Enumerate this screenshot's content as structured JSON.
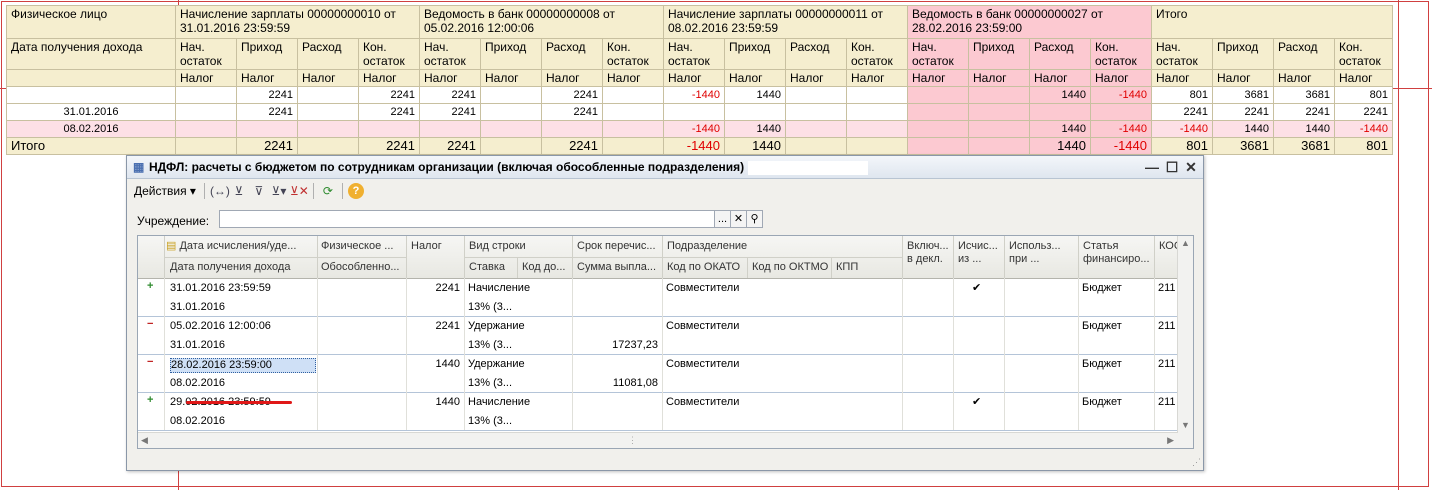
{
  "report": {
    "col_person": "Физическое лицо",
    "col_income_date": "Дата получения дохода",
    "groups": [
      {
        "title": "Начисление зарплаты 00000000010 от 31.01.2016 23:59:59"
      },
      {
        "title": "Ведомость в банк 00000000008 от 05.02.2016 12:00:06"
      },
      {
        "title": "Начисление зарплаты 00000000011 от 08.02.2016 23:59:59"
      },
      {
        "title": "Ведомость в банк 00000000027 от 28.02.2016 23:59:00"
      },
      {
        "title": "Итого"
      }
    ],
    "sub_cols": [
      "Нач. остаток",
      "Приход",
      "Расход",
      "Кон. остаток"
    ],
    "tax_label": "Налог",
    "rows": [
      {
        "label": "",
        "values": [
          "",
          "2241",
          "",
          "2241",
          "2241",
          "",
          "2241",
          "",
          "-1440",
          "1440",
          "",
          "",
          "",
          "",
          "1440",
          "-1440",
          "801",
          "3681",
          "3681",
          "801"
        ]
      },
      {
        "label": "31.01.2016",
        "values": [
          "",
          "2241",
          "",
          "2241",
          "2241",
          "",
          "2241",
          "",
          "",
          "",
          "",
          "",
          "",
          "",
          "",
          "",
          "2241",
          "2241",
          "2241",
          "2241"
        ]
      },
      {
        "label": "08.02.2016",
        "values": [
          "",
          "",
          "",
          "",
          "",
          "",
          "",
          "",
          "-1440",
          "1440",
          "",
          "",
          "",
          "",
          "1440",
          "-1440",
          "-1440",
          "1440",
          "1440",
          "-1440"
        ]
      }
    ],
    "total": {
      "label": "Итого",
      "values": [
        "",
        "2241",
        "",
        "2241",
        "2241",
        "",
        "2241",
        "",
        "-1440",
        "1440",
        "",
        "",
        "",
        "",
        "1440",
        "-1440",
        "801",
        "3681",
        "3681",
        "801"
      ]
    }
  },
  "dialog": {
    "title": "НДФЛ: расчеты с бюджетом по сотрудникам организации (включая обособленные подразделения)",
    "actions_label": "Действия",
    "institution_label": "Учреждение:",
    "institution_value": "",
    "columns": {
      "calc_date": "Дата исчисления/уде...",
      "income_date": "Дата получения дохода",
      "person": "Физическое ...",
      "separate": "Обособленно...",
      "tax": "Налог",
      "row_type": "Вид строки",
      "rate": "Ставка",
      "income_code": "Код до...",
      "transfer_term": "Срок перечис...",
      "payout_sum": "Сумма выпла...",
      "department": "Подразделение",
      "okato": "Код по ОКАТО",
      "oktmo": "Код по ОКТМО",
      "kpp": "КПП",
      "included": "Включ... в декл.",
      "excluded": "Исчис... из ...",
      "used": "Использ... при ...",
      "fin_article": "Статья финансиро...",
      "kosgu": "КОС"
    },
    "rows": [
      {
        "sign": "+",
        "calc_date": "31.01.2016 23:59:59",
        "income_date": "31.01.2016",
        "tax": "2241",
        "row_type": "Начисление",
        "rate": "13% (3...",
        "payout_sum": "",
        "department": "Совместители",
        "excluded_check": "✔",
        "fin_article": "Бюджет",
        "kosgu": "211"
      },
      {
        "sign": "−",
        "calc_date": "05.02.2016 12:00:06",
        "income_date": "31.01.2016",
        "tax": "2241",
        "row_type": "Удержание",
        "rate": "13% (3...",
        "payout_sum": "17237,23",
        "department": "Совместители",
        "excluded_check": "",
        "fin_article": "Бюджет",
        "kosgu": "211"
      },
      {
        "sign": "−",
        "calc_date": "28.02.2016 23:59:00",
        "income_date": "08.02.2016",
        "tax": "1440",
        "row_type": "Удержание",
        "rate": "13% (3...",
        "payout_sum": "11081,08",
        "department": "Совместители",
        "excluded_check": "",
        "fin_article": "Бюджет",
        "kosgu": "211"
      },
      {
        "sign": "+",
        "calc_date": "29.02.2016 23:59:59",
        "income_date": "08.02.2016",
        "tax": "1440",
        "row_type": "Начисление",
        "rate": "13% (3...",
        "payout_sum": "",
        "department": "Совместители",
        "excluded_check": "✔",
        "fin_article": "Бюджет",
        "kosgu": "211"
      }
    ]
  }
}
